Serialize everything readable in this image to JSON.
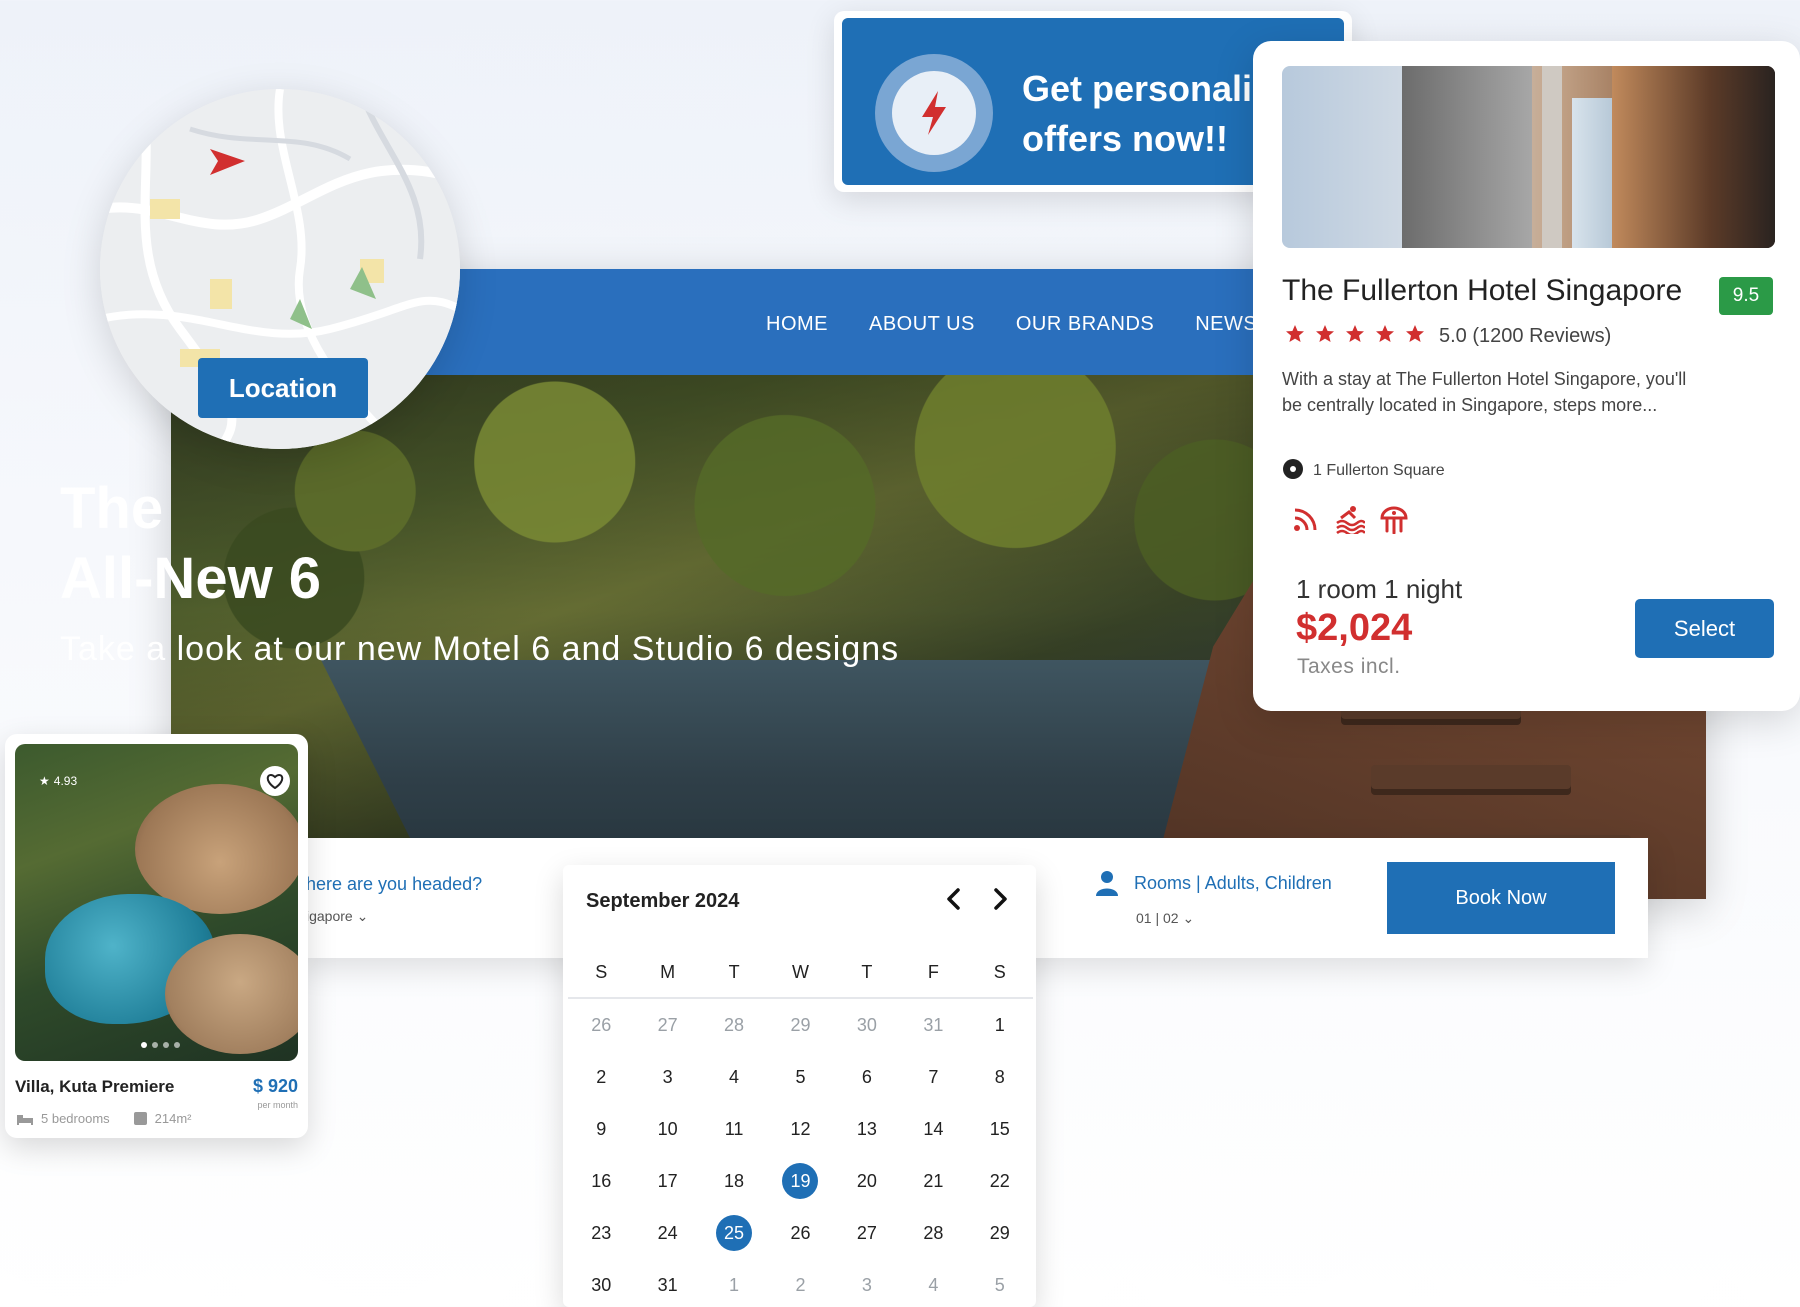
{
  "nav": {
    "items": [
      "HOME",
      "ABOUT US",
      "OUR BRANDS",
      "NEWSR"
    ]
  },
  "hero": {
    "title": "The\nAll-New 6",
    "subtitle": "Take a look at our new Motel 6 and Studio 6 designs"
  },
  "location": {
    "label": "Location"
  },
  "offer": {
    "text": "Get personalised offers now!!"
  },
  "hotel": {
    "name": "The Fullerton Hotel Singapore",
    "score": "9.5",
    "stars": 5,
    "rating_text": "5.0 (1200 Reviews)",
    "description": "With a stay at The Fullerton Hotel Singapore, you'll be centrally located in Singapore, steps more...",
    "address": "1 Fullerton Square",
    "amenities": [
      "wifi-icon",
      "pool-icon",
      "spa-icon"
    ],
    "room_night": "1 room 1 night",
    "price": "$2,024",
    "taxes": "Taxes incl.",
    "select_label": "Select"
  },
  "booking": {
    "destination_label": "here are you headed?",
    "destination_value": "igapore",
    "guests_label": "Rooms | Adults, Children",
    "guests_value": "01 | 02",
    "book_label": "Book Now"
  },
  "calendar": {
    "month_label": "September 2024",
    "weekdays": [
      "S",
      "M",
      "T",
      "W",
      "T",
      "F",
      "S"
    ],
    "days": [
      {
        "d": "26",
        "m": true
      },
      {
        "d": "27",
        "m": true
      },
      {
        "d": "28",
        "m": true
      },
      {
        "d": "29",
        "m": true
      },
      {
        "d": "30",
        "m": true
      },
      {
        "d": "31",
        "m": true
      },
      {
        "d": "1"
      },
      {
        "d": "2"
      },
      {
        "d": "3"
      },
      {
        "d": "4"
      },
      {
        "d": "5"
      },
      {
        "d": "6"
      },
      {
        "d": "7"
      },
      {
        "d": "8"
      },
      {
        "d": "9"
      },
      {
        "d": "10"
      },
      {
        "d": "11"
      },
      {
        "d": "12"
      },
      {
        "d": "13"
      },
      {
        "d": "14"
      },
      {
        "d": "15"
      },
      {
        "d": "16"
      },
      {
        "d": "17"
      },
      {
        "d": "18"
      },
      {
        "d": "19",
        "s": true
      },
      {
        "d": "20"
      },
      {
        "d": "21"
      },
      {
        "d": "22"
      },
      {
        "d": "23"
      },
      {
        "d": "24"
      },
      {
        "d": "25",
        "s": true
      },
      {
        "d": "26"
      },
      {
        "d": "27"
      },
      {
        "d": "28"
      },
      {
        "d": "29"
      },
      {
        "d": "30"
      },
      {
        "d": "31"
      },
      {
        "d": "1",
        "m": true
      },
      {
        "d": "2",
        "m": true
      },
      {
        "d": "3",
        "m": true
      },
      {
        "d": "4",
        "m": true
      },
      {
        "d": "5",
        "m": true
      }
    ]
  },
  "villa": {
    "rating": "4.93",
    "name": "Villa, Kuta Premiere",
    "price": "$ 920",
    "per": "per month",
    "bedrooms": "5 bedrooms",
    "area": "214m²",
    "slide_count": 4,
    "active_slide": 1
  },
  "colors": {
    "primary_blue": "#1f6fb5",
    "nav_blue": "#2a6fbd",
    "price_red": "#d12f2f",
    "score_green": "#2b9a47",
    "star_red": "#d12f2f"
  }
}
